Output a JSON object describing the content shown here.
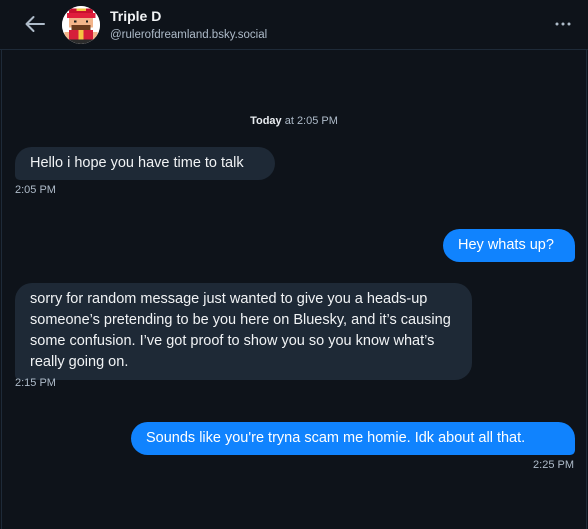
{
  "header": {
    "back_icon": "arrow-left-icon",
    "name": "Triple D",
    "handle": "@rulerofdreamland.bsky.social",
    "more_icon": "ellipsis-icon"
  },
  "date_separator": {
    "day": "Today",
    "time": " at 2:05 PM"
  },
  "messages": [
    {
      "direction": "incoming",
      "text": "Hello i hope you have time to talk",
      "time": "2:05 PM"
    },
    {
      "direction": "outgoing",
      "text": "Hey whats up?",
      "time": ""
    },
    {
      "direction": "incoming",
      "text": "sorry for random message just wanted to give you a heads-up someone’s pretending to be you here on Bluesky, and it’s causing some confusion. I’ve got proof to show you so you know what’s really going on.",
      "time": "2:15 PM"
    },
    {
      "direction": "outgoing",
      "text": "Sounds like you're tryna scam me homie. Idk about all that.",
      "time": "2:25 PM"
    }
  ],
  "colors": {
    "background": "#0e131a",
    "incoming_bubble": "#1e2936",
    "outgoing_bubble": "#1083fe",
    "secondary_text": "#aebbc9"
  }
}
